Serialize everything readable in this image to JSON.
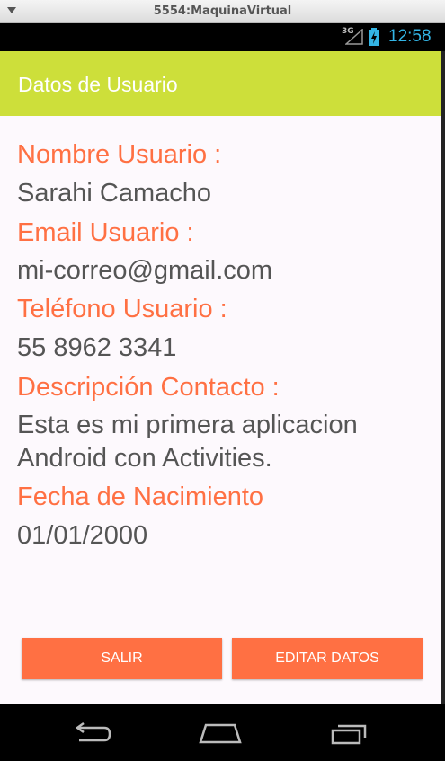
{
  "window": {
    "title": "5554:MaquinaVirtual"
  },
  "statusbar": {
    "network": "3G",
    "time": "12:58"
  },
  "actionbar": {
    "title": "Datos de Usuario"
  },
  "fields": [
    {
      "label": "Nombre Usuario :",
      "value": "Sarahi Camacho"
    },
    {
      "label": "Email Usuario :",
      "value": "mi-correo@gmail.com"
    },
    {
      "label": "Teléfono Usuario :",
      "value": "55 8962 3341"
    },
    {
      "label": "Descripción Contacto :",
      "value": "Esta es mi primera aplicacion Android con Activities."
    },
    {
      "label": "Fecha de Nacimiento",
      "value": "01/01/2000"
    }
  ],
  "buttons": {
    "exit_label": "SALIR",
    "edit_label": "EDITAR DATOS"
  },
  "colors": {
    "accent": "#ff7043",
    "actionbar": "#cddf3a",
    "clock": "#33b5e5"
  },
  "icons": {
    "back": "back-icon",
    "home": "home-icon",
    "recents": "recents-icon"
  }
}
